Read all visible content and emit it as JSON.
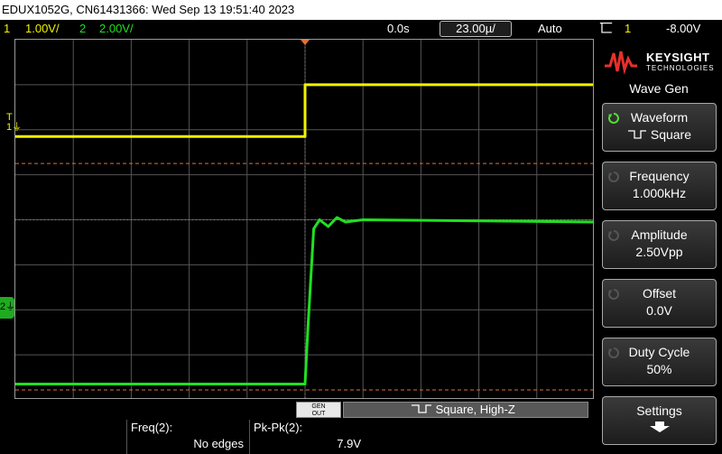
{
  "titlebar": {
    "text": "EDUX1052G, CN61431366: Wed Sep 13 19:51:40 2023"
  },
  "status": {
    "ch1_num": "1",
    "ch1_scale": "1.00V/",
    "ch2_num": "2",
    "ch2_scale": "2.00V/",
    "time_delay": "0.0s",
    "timebase": "23.00µ/",
    "trigger_mode": "Auto",
    "trigger_source_num": "1",
    "trigger_level": "-8.00V"
  },
  "markers": {
    "trigger": "T",
    "ch1": "1",
    "ch2": "2"
  },
  "panel": {
    "brand": "KEYSIGHT",
    "brand_sub": "TECHNOLOGIES",
    "menu_title": "Wave Gen",
    "softkeys": [
      {
        "label": "Waveform",
        "value": "Square"
      },
      {
        "label": "Frequency",
        "value": "1.000kHz"
      },
      {
        "label": "Amplitude",
        "value": "2.50Vpp"
      },
      {
        "label": "Offset",
        "value": "0.0V"
      },
      {
        "label": "Duty Cycle",
        "value": "50%"
      },
      {
        "label": "Settings",
        "value": ""
      }
    ]
  },
  "gen": {
    "badge_line1": "GEN",
    "badge_line2": "OUT",
    "status": "Square, High-Z"
  },
  "measurements": [
    {
      "label": "Freq(2):",
      "value": "No edges"
    },
    {
      "label": "Pk-Pk(2):",
      "value": "7.9V"
    }
  ],
  "colors": {
    "ch1": "#f2f200",
    "ch2": "#20e020",
    "trigger_line": "#e0703a",
    "grid": "#555555"
  },
  "chart_data": {
    "type": "line",
    "x_unit": "div",
    "y_unit": "div",
    "xlim": [
      0,
      10
    ],
    "ylim": [
      0,
      8
    ],
    "grid": true,
    "series": [
      {
        "name": "1",
        "x": [
          0,
          5,
          5,
          10
        ],
        "y": [
          5.85,
          5.85,
          7.0,
          7.0
        ]
      },
      {
        "name": "2",
        "x": [
          0,
          5.0,
          5.05,
          5.15,
          5.25,
          5.4,
          5.55,
          5.7,
          6.0,
          10
        ],
        "y": [
          0.35,
          0.35,
          1.6,
          3.8,
          4.0,
          3.85,
          4.05,
          3.95,
          4.0,
          3.95
        ]
      }
    ],
    "trigger_level_y": 5.25,
    "reference_y": 0.22
  }
}
